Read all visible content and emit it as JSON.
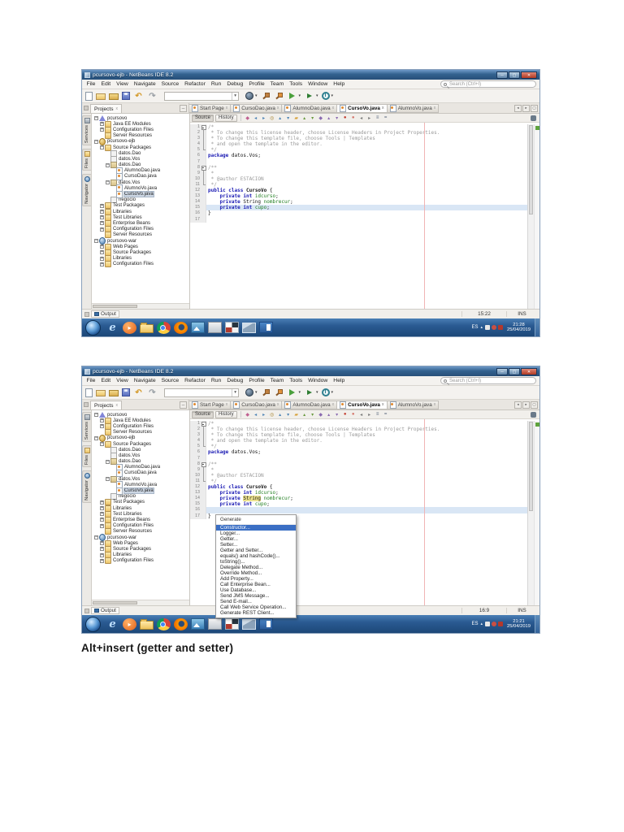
{
  "page": {
    "caption": "Alt+insert (getter and setter)"
  },
  "ide": {
    "title": "pcursovo-ejb - NetBeans IDE 8.2",
    "menu": [
      "File",
      "Edit",
      "View",
      "Navigate",
      "Source",
      "Refactor",
      "Run",
      "Debug",
      "Profile",
      "Team",
      "Tools",
      "Window",
      "Help"
    ],
    "search_placeholder": "Search (Ctrl+I)",
    "panel_tab": "Projects",
    "side_tabs": [
      {
        "label": "Services",
        "icon": "services-icon"
      },
      {
        "label": "Files",
        "icon": "files-icon"
      },
      {
        "label": "Navigator",
        "icon": "navigator-icon"
      }
    ],
    "editor_tabs": [
      {
        "label": "Start Page",
        "icon": "java-file-icon",
        "active": false
      },
      {
        "label": "CursoDao.java",
        "icon": "java-file-icon",
        "active": false
      },
      {
        "label": "AlumnoDao.java",
        "icon": "java-file-icon",
        "active": false
      },
      {
        "label": "CursoVo.java",
        "icon": "java-file-icon",
        "active": true
      },
      {
        "label": "AlumnoVo.java",
        "icon": "java-file-icon",
        "active": false
      }
    ],
    "editor_views": [
      "Source",
      "History"
    ],
    "output_label": "Output",
    "toolbar_left_icons": [
      "new-file-icon",
      "new-project-icon",
      "open-project-icon",
      "save-all-icon",
      "undo-icon",
      "redo-icon"
    ],
    "toolbar_right_icons": [
      "deploy-icon",
      "build-icon",
      "clean-build-icon",
      "run-icon",
      "debug-icon",
      "profile-icon"
    ],
    "editor_toolbar_icons": [
      "last-edit-icon",
      "back-icon",
      "forward-icon",
      "find-selection-icon",
      "find-previous-icon",
      "find-next-icon",
      "toggle-highlight-icon",
      "previous-occurrence-icon",
      "next-occurrence-icon",
      "toggle-bookmark-icon",
      "previous-bookmark-icon",
      "next-bookmark-icon",
      "previous-error-icon",
      "next-error-icon",
      "shift-left-icon",
      "shift-right-icon",
      "comment-icon",
      "uncomment-icon"
    ],
    "taskbar_icons": [
      "internet-explorer-icon",
      "media-player-icon",
      "file-explorer-icon",
      "chrome-icon",
      "firefox-icon",
      "photo-viewer-icon",
      "sticky-notes-icon",
      "netbeans-icon",
      "virtualbox-icon",
      "word-icon"
    ],
    "tray_icons": [
      "network-icon",
      "volume-icon",
      "security-icon"
    ],
    "tree": [
      {
        "l": 0,
        "e": "m",
        "i": "enterprise-app-icon",
        "x": "pcursovo"
      },
      {
        "l": 1,
        "e": "p",
        "i": "folder-icon",
        "x": "Java EE Modules"
      },
      {
        "l": 1,
        "e": "p",
        "i": "folder-icon",
        "x": "Configuration Files"
      },
      {
        "l": 1,
        "e": "",
        "i": "folder-icon",
        "x": "Server Resources"
      },
      {
        "l": 0,
        "e": "m",
        "i": "ejb-module-icon",
        "x": "pcursovo-ejb"
      },
      {
        "l": 1,
        "e": "m",
        "i": "folder-icon",
        "x": "Source Packages"
      },
      {
        "l": 2,
        "e": "",
        "i": "empty-package-icon",
        "x": "datos.Dao"
      },
      {
        "l": 2,
        "e": "",
        "i": "empty-package-icon",
        "x": "datos.Vos"
      },
      {
        "l": 2,
        "e": "m",
        "i": "package-icon",
        "x": "datos.Dao"
      },
      {
        "l": 3,
        "e": "",
        "i": "java-file-icon",
        "x": "AlumnoDao.java"
      },
      {
        "l": 3,
        "e": "",
        "i": "java-file-icon",
        "x": "CursoDao.java"
      },
      {
        "l": 2,
        "e": "m",
        "i": "package-icon",
        "x": "datos.Vos"
      },
      {
        "l": 3,
        "e": "",
        "i": "java-file-icon",
        "x": "AlumnoVo.java"
      },
      {
        "l": 3,
        "e": "",
        "i": "java-file-icon",
        "x": "CursoVo.java",
        "sel": true
      },
      {
        "l": 2,
        "e": "",
        "i": "empty-package-icon",
        "x": "negocio"
      },
      {
        "l": 1,
        "e": "p",
        "i": "folder-icon",
        "x": "Test Packages"
      },
      {
        "l": 1,
        "e": "p",
        "i": "folder-icon",
        "x": "Libraries"
      },
      {
        "l": 1,
        "e": "p",
        "i": "folder-icon",
        "x": "Test Libraries"
      },
      {
        "l": 1,
        "e": "p",
        "i": "folder-icon",
        "x": "Enterprise Beans"
      },
      {
        "l": 1,
        "e": "p",
        "i": "folder-icon",
        "x": "Configuration Files"
      },
      {
        "l": 1,
        "e": "",
        "i": "folder-icon",
        "x": "Server Resources"
      },
      {
        "l": 0,
        "e": "m",
        "i": "web-module-icon",
        "x": "pcursovo-war"
      },
      {
        "l": 1,
        "e": "p",
        "i": "folder-icon",
        "x": "Web Pages"
      },
      {
        "l": 1,
        "e": "p",
        "i": "folder-icon",
        "x": "Source Packages"
      },
      {
        "l": 1,
        "e": "p",
        "i": "folder-icon",
        "x": "Libraries"
      },
      {
        "l": 1,
        "e": "p",
        "i": "folder-icon",
        "x": "Configuration Files"
      }
    ]
  },
  "shots": {
    "shot1": {
      "status_position": "15:22",
      "status_mode": "INS",
      "tray_lang": "ES",
      "tray_time": "21:28",
      "tray_date": "25/04/2019",
      "caret_line": 15,
      "code": [
        {
          "n": 1,
          "f": "s",
          "s": [
            [
              "c",
              "/*"
            ]
          ]
        },
        {
          "n": 2,
          "f": "m",
          "s": [
            [
              "c",
              " * To change this license header, choose License Headers in Project Properties."
            ]
          ]
        },
        {
          "n": 3,
          "f": "m",
          "s": [
            [
              "c",
              " * To change this template file, choose Tools | Templates"
            ]
          ]
        },
        {
          "n": 4,
          "f": "m",
          "s": [
            [
              "c",
              " * and open the template in the editor."
            ]
          ]
        },
        {
          "n": 5,
          "f": "e",
          "s": [
            [
              "c",
              " */"
            ]
          ]
        },
        {
          "n": 6,
          "f": "",
          "s": [
            [
              "k",
              "package "
            ],
            [
              "p",
              "datos.Vos;"
            ]
          ]
        },
        {
          "n": 7,
          "f": "",
          "s": []
        },
        {
          "n": 8,
          "f": "s",
          "s": [
            [
              "c",
              "/**"
            ]
          ]
        },
        {
          "n": 9,
          "f": "m",
          "s": [
            [
              "c",
              " *"
            ]
          ]
        },
        {
          "n": 10,
          "f": "m",
          "s": [
            [
              "c",
              " * @author ESTACION"
            ]
          ]
        },
        {
          "n": 11,
          "f": "e",
          "s": [
            [
              "c",
              " */"
            ]
          ]
        },
        {
          "n": 12,
          "f": "",
          "s": [
            [
              "k",
              "public "
            ],
            [
              "k",
              "class "
            ],
            [
              "b",
              "CursoVo "
            ],
            [
              "p",
              "{"
            ]
          ]
        },
        {
          "n": 13,
          "f": "",
          "s": [
            [
              "p",
              "    "
            ],
            [
              "k",
              "private "
            ],
            [
              "k",
              "int "
            ],
            [
              "f",
              "idcurso"
            ],
            [
              "p",
              ";"
            ]
          ]
        },
        {
          "n": 14,
          "f": "",
          "s": [
            [
              "p",
              "    "
            ],
            [
              "k",
              "private "
            ],
            [
              "p",
              "String "
            ],
            [
              "f",
              "nombrecur"
            ],
            [
              "p",
              ";"
            ]
          ]
        },
        {
          "n": 15,
          "f": "",
          "s": [
            [
              "p",
              "    "
            ],
            [
              "k",
              "private "
            ],
            [
              "k",
              "int "
            ],
            [
              "f",
              "cupo"
            ],
            [
              "p",
              ";"
            ]
          ]
        },
        {
          "n": 16,
          "f": "",
          "s": [
            [
              "p",
              "}"
            ]
          ]
        },
        {
          "n": 17,
          "f": "",
          "s": []
        }
      ]
    },
    "shot2": {
      "status_position": "16:9",
      "status_mode": "INS",
      "tray_lang": "ES",
      "tray_time": "21:21",
      "tray_date": "25/04/2019",
      "caret_line": 16,
      "code": [
        {
          "n": 1,
          "f": "s",
          "s": [
            [
              "c",
              "/*"
            ]
          ]
        },
        {
          "n": 2,
          "f": "m",
          "s": [
            [
              "c",
              " * To change this license header, choose License Headers in Project Properties."
            ]
          ]
        },
        {
          "n": 3,
          "f": "m",
          "s": [
            [
              "c",
              " * To change this template file, choose Tools | Templates"
            ]
          ]
        },
        {
          "n": 4,
          "f": "m",
          "s": [
            [
              "c",
              " * and open the template in the editor."
            ]
          ]
        },
        {
          "n": 5,
          "f": "e",
          "s": [
            [
              "c",
              " */"
            ]
          ]
        },
        {
          "n": 6,
          "f": "",
          "s": [
            [
              "k",
              "package "
            ],
            [
              "p",
              "datos.Vos;"
            ]
          ]
        },
        {
          "n": 7,
          "f": "",
          "s": []
        },
        {
          "n": 8,
          "f": "s",
          "s": [
            [
              "c",
              "/**"
            ]
          ]
        },
        {
          "n": 9,
          "f": "m",
          "s": [
            [
              "c",
              " *"
            ]
          ]
        },
        {
          "n": 10,
          "f": "m",
          "s": [
            [
              "c",
              " * @author ESTACION"
            ]
          ]
        },
        {
          "n": 11,
          "f": "e",
          "s": [
            [
              "c",
              " */"
            ]
          ]
        },
        {
          "n": 12,
          "f": "",
          "s": [
            [
              "k",
              "public "
            ],
            [
              "k",
              "class "
            ],
            [
              "b",
              "CursoVo "
            ],
            [
              "p",
              "{"
            ]
          ]
        },
        {
          "n": 13,
          "f": "",
          "s": [
            [
              "p",
              "    "
            ],
            [
              "k",
              "private "
            ],
            [
              "k",
              "int "
            ],
            [
              "f",
              "idcurso"
            ],
            [
              "p",
              ";"
            ]
          ]
        },
        {
          "n": 14,
          "f": "",
          "s": [
            [
              "p",
              "    "
            ],
            [
              "k",
              "private "
            ],
            [
              "hl",
              "String"
            ],
            [
              "p",
              " "
            ],
            [
              "f",
              "nombrecur"
            ],
            [
              "p",
              ";"
            ]
          ]
        },
        {
          "n": 15,
          "f": "",
          "s": [
            [
              "p",
              "    "
            ],
            [
              "k",
              "private "
            ],
            [
              "k",
              "int "
            ],
            [
              "f",
              "cupo"
            ],
            [
              "p",
              ";"
            ]
          ]
        },
        {
          "n": 16,
          "f": "",
          "s": []
        },
        {
          "n": 17,
          "f": "",
          "s": [
            [
              "p",
              "}"
            ]
          ]
        }
      ],
      "generate_menu": {
        "title": "Generate",
        "selected_item": "Constructor...",
        "items": [
          "Constructor...",
          "Logger...",
          "Getter...",
          "Setter...",
          "Getter and Setter...",
          "equals() and hashCode()...",
          "toString()...",
          "Delegate Method...",
          "Override Method...",
          "Add Property...",
          "Call Enterprise Bean...",
          "Use Database...",
          "Send JMS Message...",
          "Send E-mail...",
          "Call Web Service Operation...",
          "Generate REST Client..."
        ]
      }
    }
  }
}
